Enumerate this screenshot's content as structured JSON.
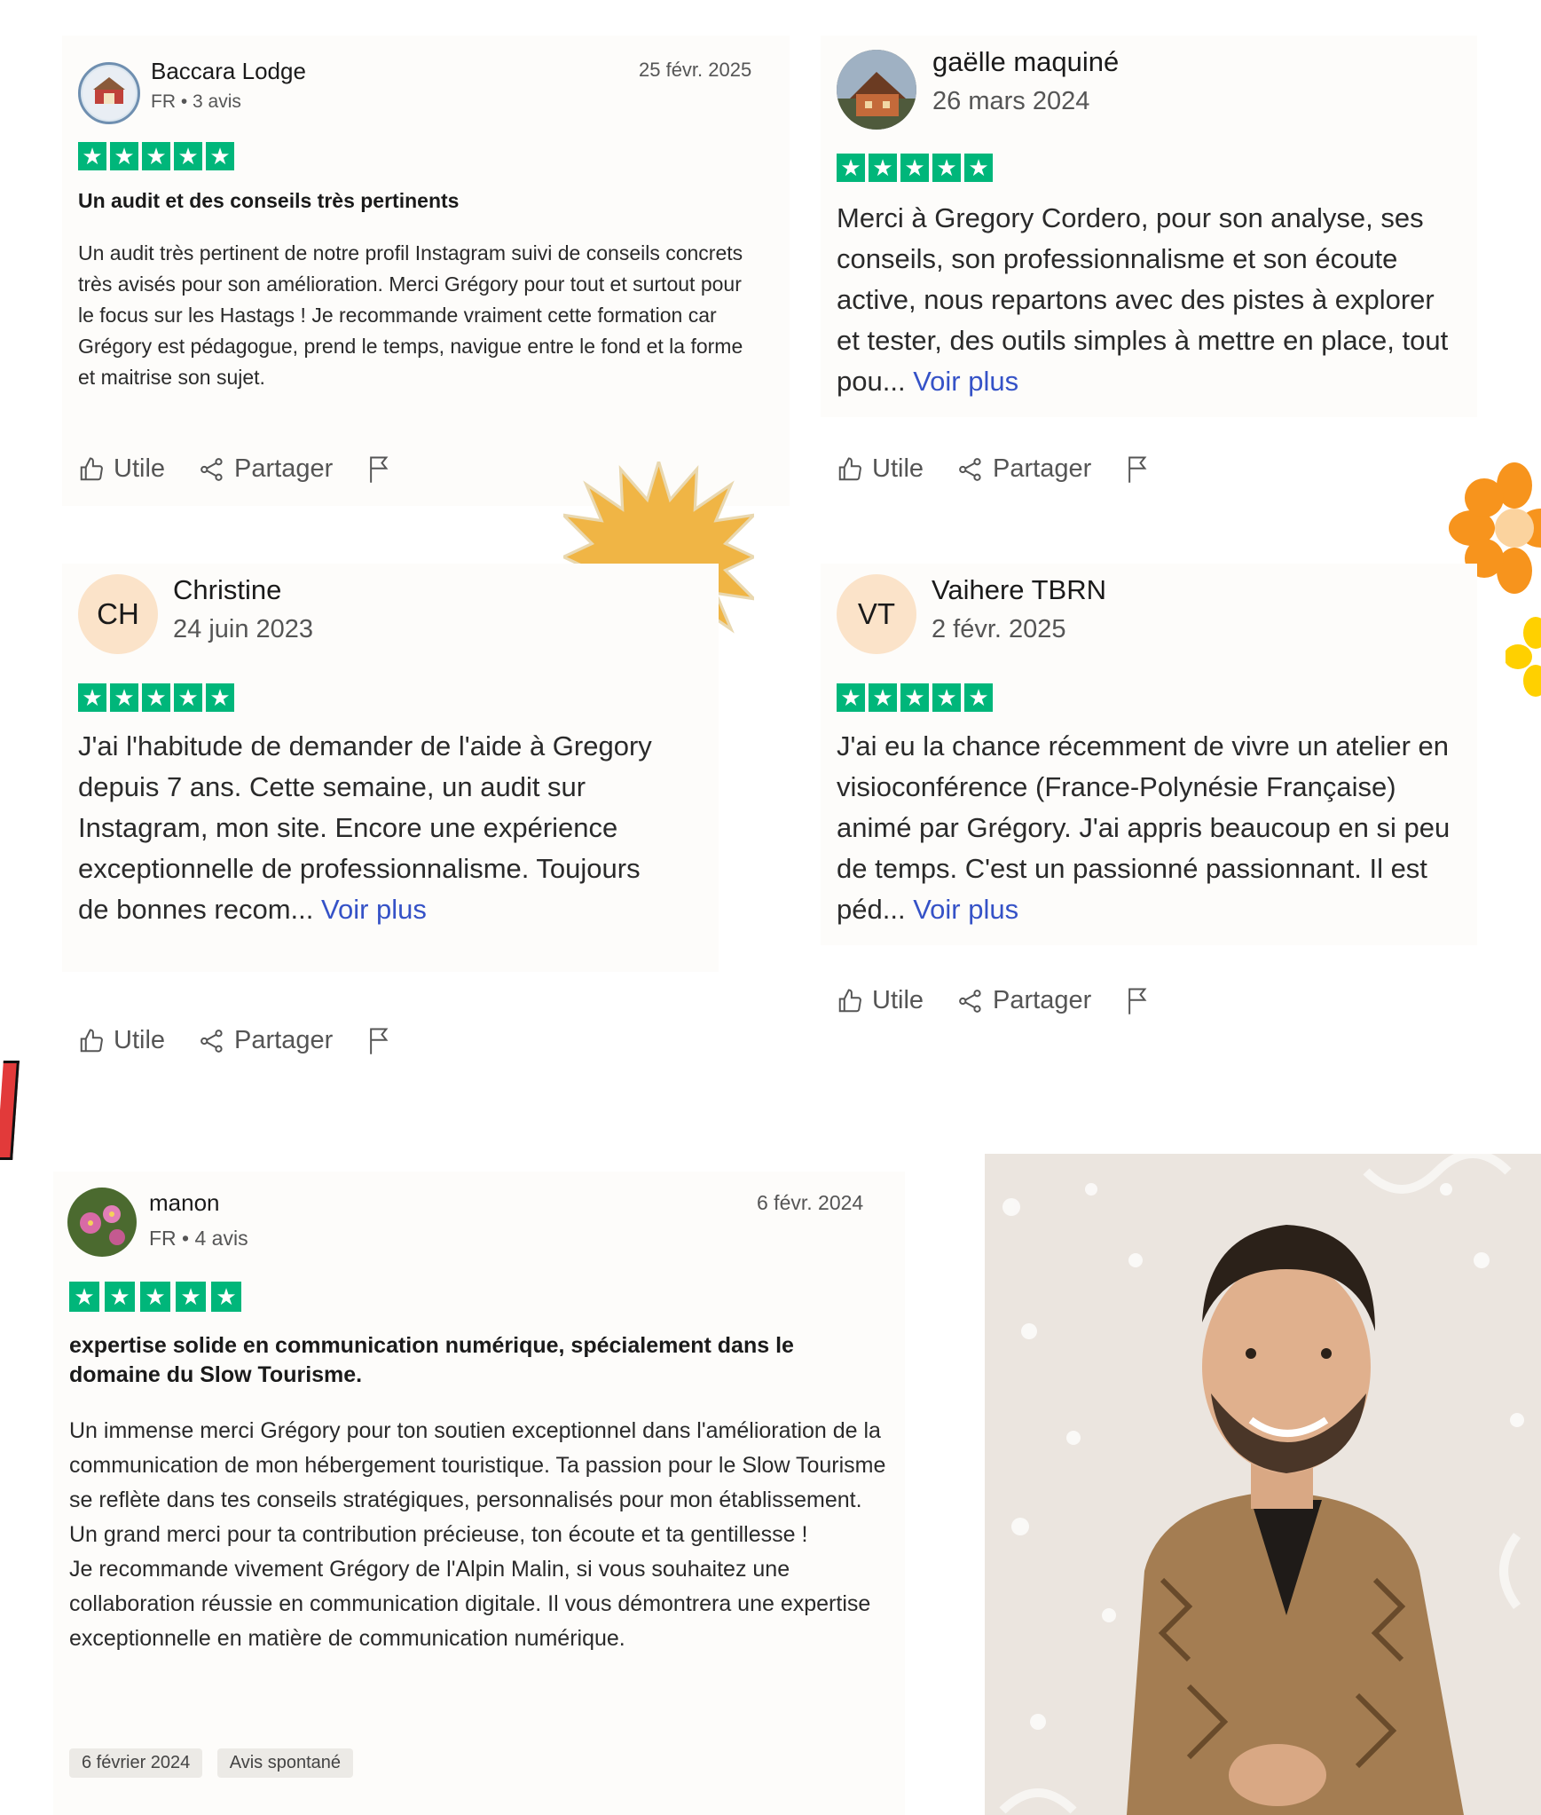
{
  "reviews": [
    {
      "name": "Baccara Lodge",
      "meta": "FR • 3 avis",
      "date": "25 févr. 2025",
      "stars": [
        "★",
        "★",
        "★",
        "★",
        "★"
      ],
      "title": "Un audit et des conseils très pertinents",
      "body": "Un audit très pertinent de notre profil Instagram suivi de conseils concrets très avisés pour son amélioration. Merci Grégory pour tout et surtout pour le focus sur les Hastags ! Je recommande vraiment cette formation car Grégory est pédagogue, prend le temps, navigue entre le fond et la forme et maitrise son sujet."
    },
    {
      "name": "gaëlle maquiné",
      "date": "26 mars 2024",
      "stars": [
        "★",
        "★",
        "★",
        "★",
        "★"
      ],
      "body": "Merci à Gregory Cordero, pour son analyse, ses conseils, son professionnalisme et son écoute active, nous repartons avec des pistes à explorer et tester, des outils simples à mettre en place, tout pou...",
      "more": "Voir plus"
    },
    {
      "name": "Christine",
      "initials": "CH",
      "date": "24 juin 2023",
      "stars": [
        "★",
        "★",
        "★",
        "★",
        "★"
      ],
      "body": "J'ai l'habitude de demander de l'aide à Gregory depuis 7 ans. Cette semaine, un audit sur Instagram, mon site. Encore une expérience exceptionnelle de professionnalisme. Toujours de bonnes recom...",
      "more": "Voir plus"
    },
    {
      "name": "Vaihere TBRN",
      "initials": "VT",
      "date": "2 févr. 2025",
      "stars": [
        "★",
        "★",
        "★",
        "★",
        "★"
      ],
      "body": "J'ai eu la chance récemment de vivre un atelier en visioconférence (France-Polynésie Française) animé par Grégory. J'ai appris beaucoup en si peu de temps. C'est un passionné passionnant. Il est péd...",
      "more": "Voir plus"
    },
    {
      "name": "manon",
      "meta": "FR • 4 avis",
      "date": "6 févr. 2024",
      "stars": [
        "★",
        "★",
        "★",
        "★",
        "★"
      ],
      "title": "expertise solide en communication numérique, spécialement dans le domaine du Slow Tourisme.",
      "body_lines": [
        "Un immense merci Grégory pour ton soutien exceptionnel dans l'amélioration de la communication de mon hébergement touristique. Ta passion pour le Slow Tourisme se reflète dans tes conseils stratégiques, personnalisés pour mon établissement.",
        "Un grand merci pour ta contribution précieuse, ton écoute et ta gentillesse !",
        "Je recommande vivement Grégory de l'Alpin Malin, si vous souhaitez une collaboration réussie en communication digitale. Il vous démontrera une expertise exceptionnelle en matière de communication numérique."
      ],
      "tags": [
        "6 février 2024",
        "Avis spontané"
      ]
    }
  ],
  "actions": {
    "helpful": "Utile",
    "share": "Partager"
  },
  "icons": {
    "helpful": "thumbs-up-icon",
    "share": "share-icon",
    "report": "flag-icon",
    "decor_sun": "sun-burst-icon",
    "decor_flower": "flower-icon"
  },
  "colors": {
    "star_green": "#00b67a",
    "link_blue": "#3552c7",
    "initials_bg": "#fbe3c9",
    "sun": "#f0b545",
    "flower_orange": "#f7941d",
    "flower_yellow": "#ffd000"
  }
}
